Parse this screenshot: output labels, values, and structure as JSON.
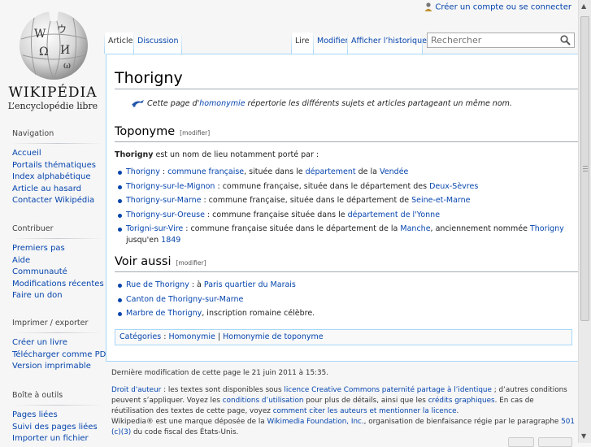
{
  "personal": {
    "create_account": "Créer un compte ou se connecter"
  },
  "logo": {
    "wordmark": "Wikipédia",
    "tagline": "L’encyclopédie libre"
  },
  "tabs": {
    "left": [
      "Article",
      "Discussion"
    ],
    "right": [
      "Lire",
      "Modifier",
      "Afficher l’historique"
    ]
  },
  "search": {
    "placeholder": "Rechercher"
  },
  "sidebar": {
    "navigation": {
      "title": "Navigation",
      "items": [
        "Accueil",
        "Portails thématiques",
        "Index alphabétique",
        "Article au hasard",
        "Contacter Wikipédia"
      ]
    },
    "contribute": {
      "title": "Contribuer",
      "items": [
        "Premiers pas",
        "Aide",
        "Communauté",
        "Modifications récentes",
        "Faire un don"
      ]
    },
    "print": {
      "title": "Imprimer / exporter",
      "items": [
        "Créer un livre",
        "Télécharger comme PDF",
        "Version imprimable"
      ]
    },
    "tools": {
      "title": "Boîte à outils",
      "items": [
        "Pages liées",
        "Suivi des pages liées",
        "Importer un fichier"
      ]
    }
  },
  "article": {
    "title": "Thorigny",
    "hatnote": {
      "pre": "Cette page d'",
      "link": "homonymie",
      "post": " répertorie les différents sujets et articles partageant un même nom."
    },
    "edit_label": "[modifier]",
    "section1": {
      "heading": "Toponyme",
      "intro_bold": "Thorigny",
      "intro_rest": " est un nom de lieu notamment porté par :",
      "items": [
        [
          [
            "Thorigny",
            "link"
          ],
          [
            " : ",
            "t"
          ],
          [
            "commune française",
            "link"
          ],
          [
            ", située dans le ",
            "t"
          ],
          [
            "département",
            "link"
          ],
          [
            " de la ",
            "t"
          ],
          [
            "Vendée",
            "link"
          ]
        ],
        [
          [
            "Thorigny-sur-le-Mignon",
            "link"
          ],
          [
            " : commune française, située dans le département des ",
            "t"
          ],
          [
            "Deux-Sèvres",
            "link"
          ]
        ],
        [
          [
            "Thorigny-sur-Marne",
            "link"
          ],
          [
            " : commune française, située dans le département de ",
            "t"
          ],
          [
            "Seine-et-Marne",
            "link"
          ]
        ],
        [
          [
            "Thorigny-sur-Oreuse",
            "link"
          ],
          [
            " : commune française située dans le ",
            "t"
          ],
          [
            "département de l'Yonne",
            "link"
          ]
        ],
        [
          [
            "Torigni-sur-Vire",
            "link"
          ],
          [
            " : commune française située dans le département de la ",
            "t"
          ],
          [
            "Manche",
            "link"
          ],
          [
            ", anciennement nommée ",
            "t"
          ],
          [
            "Thorigny",
            "link"
          ],
          [
            " jusqu'en ",
            "t"
          ],
          [
            "1849",
            "link"
          ]
        ]
      ]
    },
    "section2": {
      "heading": "Voir aussi",
      "items": [
        [
          [
            "Rue de Thorigny",
            "link"
          ],
          [
            " : à ",
            "t"
          ],
          [
            "Paris",
            "link"
          ],
          [
            " ",
            "t"
          ],
          [
            "quartier du Marais",
            "link"
          ]
        ],
        [
          [
            "Canton de Thorigny-sur-Marne",
            "link"
          ]
        ],
        [
          [
            "Marbre de Thorigny",
            "link"
          ],
          [
            ", inscription romaine célèbre.",
            "t"
          ]
        ]
      ]
    },
    "categories": {
      "label": "Catégories",
      "items": [
        "Homonymie",
        "Homonymie de toponyme"
      ]
    }
  },
  "footer": {
    "lastmod": "Dernière modification de cette page le 21 juin 2011 à 15:35.",
    "legal": [
      [
        "Droit d'auteur",
        "link"
      ],
      [
        " : les textes sont disponibles sous ",
        "t"
      ],
      [
        "licence Creative Commons paternité partage à l’identique",
        "link"
      ],
      [
        " ; d’autres conditions peuvent s’appliquer. Voyez les ",
        "t"
      ],
      [
        "conditions d’utilisation",
        "link"
      ],
      [
        " pour plus de détails, ainsi que les ",
        "t"
      ],
      [
        "crédits graphiques",
        "link"
      ],
      [
        ". En cas de réutilisation des textes de cette page, voyez ",
        "t"
      ],
      [
        "comment citer les auteurs et mentionner la licence",
        "link"
      ],
      [
        ".",
        "t"
      ]
    ],
    "trademark": [
      [
        "Wikipedia® est une marque déposée de la ",
        "t"
      ],
      [
        "Wikimedia Foundation, Inc.",
        "link"
      ],
      [
        ", organisation de bienfaisance régie par le paragraphe ",
        "t"
      ],
      [
        "501 (c)(3)",
        "link"
      ],
      [
        " du code fiscal des États-Unis.",
        "t"
      ]
    ]
  }
}
